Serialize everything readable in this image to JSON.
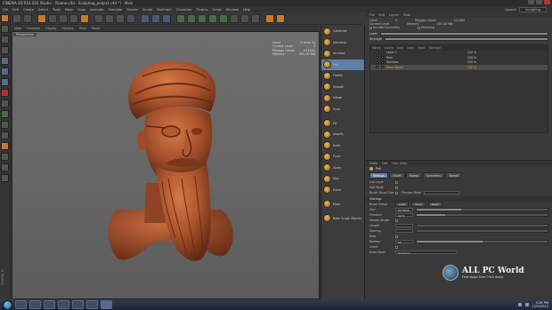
{
  "window": {
    "title": "CINEMA 4D R14.031 Studio - [Scene.c4d - Sculpting_project.c4d *] - Main"
  },
  "menubar": {
    "items": [
      "File",
      "Edit",
      "Create",
      "Select",
      "Tools",
      "Mesh",
      "Snap",
      "Animate",
      "Simulate",
      "Render",
      "Sculpt",
      "MoGraph",
      "Character",
      "Plugins",
      "Script",
      "Window",
      "Help"
    ],
    "layout_label": "Layout:",
    "layout_value": "Sculpting"
  },
  "viewport": {
    "menu": [
      "View",
      "Cameras",
      "Display",
      "Options",
      "Filter",
      "Panel"
    ],
    "tag": "Perspective",
    "stats": [
      {
        "k": "Level",
        "v": "4 (max 5)"
      },
      {
        "k": "Current Level",
        "v": "4"
      },
      {
        "k": "Polygon Count",
        "v": "412400"
      },
      {
        "k": "Memory",
        "v": "201.00 MB"
      }
    ]
  },
  "sidebar": {
    "left_label": "CINEMA 4D"
  },
  "brushes": {
    "items": [
      {
        "label": "Subdivide"
      },
      {
        "label": "Decrease"
      },
      {
        "label": "Increase"
      },
      {
        "label": "Pull",
        "selected": true
      },
      {
        "label": "Flatten"
      },
      {
        "label": "Smooth"
      },
      {
        "label": "Inflate"
      },
      {
        "label": "Grab"
      },
      {
        "label": "Fill",
        "sep": true
      },
      {
        "label": "Amplify"
      },
      {
        "label": "Knife"
      },
      {
        "label": "Pinch"
      },
      {
        "label": "Spray"
      },
      {
        "label": "Wax"
      },
      {
        "label": "Erase"
      },
      {
        "label": "Mask",
        "sep": true
      },
      {
        "label": "Bake Sculpt Objects",
        "sep": true
      }
    ]
  },
  "layers": {
    "menu": [
      "File",
      "Edit",
      "Layers",
      "Mask"
    ],
    "info": {
      "level_label": "Level",
      "level_value": "4",
      "current_label": "Current Level",
      "polygon_label": "Polygon Count",
      "polygon_value": "412400",
      "memory_label": "Memory",
      "memory_value": "201.00 MB",
      "include_label": "Include Symmetry",
      "mirror_label": "Mirroring"
    },
    "level_bar": "Level",
    "strength_label": "Strength",
    "strength_value": "100 %",
    "header": [
      "Name",
      "Visible",
      "Lock",
      "Level",
      "Mask",
      "Strength"
    ],
    "rows": [
      {
        "name": "Layer 1",
        "pct": "100 %"
      },
      {
        "name": "Face",
        "pct": "100 %"
      },
      {
        "name": "Wrinkles",
        "pct": "100 %"
      },
      {
        "name": "Base Object",
        "pct": "100 %",
        "selected": true
      }
    ]
  },
  "attributes": {
    "menu": [
      "Mode",
      "Edit",
      "User Data"
    ],
    "title": "Pull",
    "tabs": [
      {
        "label": "Settings",
        "active": true
      },
      {
        "label": "Falloff"
      },
      {
        "label": "Stamp"
      },
      {
        "label": "Symmetry"
      },
      {
        "label": "Stencil"
      }
    ],
    "props1": [
      {
        "k": "Use Layer",
        "v": ""
      },
      {
        "k": "Edit Mode",
        "v": ""
      },
      {
        "k": "Brush Visual Size",
        "v": "Preview Mode"
      }
    ],
    "section": "Settings",
    "preset_label": "Brush Preset",
    "preset_btns": [
      "Load",
      "Save",
      "Reset"
    ],
    "size_label": "Size",
    "size_value": "34.3893",
    "pressure_label": "Pressure",
    "pressure_value": "22 %",
    "steady_label": "Steady Stroke",
    "length_label": "Length",
    "spacing_label": "Spacing",
    "dots_label": "Dots",
    "buildup_label": "Buildup",
    "buildup_value": "50",
    "invert_label": "Invert",
    "draw_label": "Draw Mode",
    "draw_value": "Freehand"
  },
  "watermark": {
    "title": "ALL PC World",
    "subtitle": "Free Apps One Click Away"
  },
  "taskbar": {
    "time": "4:26 PM",
    "date": "1/20/2013"
  }
}
